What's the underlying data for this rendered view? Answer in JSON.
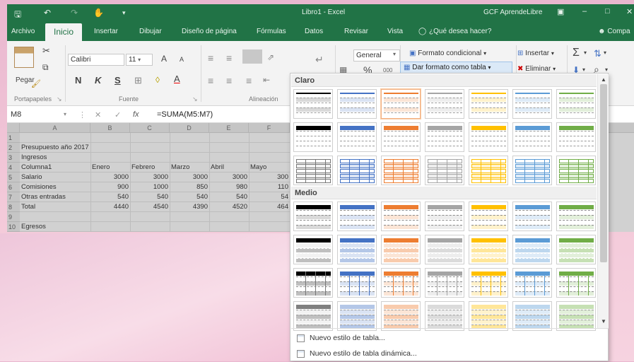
{
  "titlebar": {
    "doc_title": "Libro1  -  Excel",
    "user": "GCF AprendeLibre",
    "save_icon": "🖫",
    "undo_icon": "↶",
    "redo_icon": "↷",
    "touch_icon": "✋",
    "dropdown_icon": "▾",
    "ribbon_opts_icon": "▣",
    "minimize_icon": "–",
    "restore_icon": "□",
    "close_icon": "✕"
  },
  "tabs": [
    {
      "label": "Archivo",
      "active": false
    },
    {
      "label": "Inicio",
      "active": true
    },
    {
      "label": "Insertar",
      "active": false
    },
    {
      "label": "Dibujar",
      "active": false
    },
    {
      "label": "Diseño de página",
      "active": false
    },
    {
      "label": "Fórmulas",
      "active": false
    },
    {
      "label": "Datos",
      "active": false
    },
    {
      "label": "Revisar",
      "active": false
    },
    {
      "label": "Vista",
      "active": false
    }
  ],
  "tellme": "¿Qué desea hacer?",
  "share": "Compa",
  "ribbon": {
    "paste_label": "Pegar",
    "clipboard_group": "Portapapeles",
    "font_name": "Calibri",
    "font_size": "11",
    "bold": "N",
    "italic": "K",
    "underline": "S",
    "grow_font": "A",
    "shrink_font": "A",
    "font_color": "A",
    "font_group": "Fuente",
    "alignment_group": "Alineación",
    "number_format": "General",
    "percent": "%",
    "comma": "000",
    "conditional_format": "Formato condicional",
    "format_as_table": "Dar formato como tabla",
    "insert": "Insertar",
    "delete": "Eliminar",
    "sum_icon": "Σ",
    "sort_icon": "⇅",
    "find_icon": "⌕",
    "fill_icon": "⬇",
    "clear_icon": "✖",
    "dropdown_arrow": "▾",
    "launcher_icon": "↘"
  },
  "formula_bar": {
    "name_box": "M8",
    "cancel": "✕",
    "enter": "✓",
    "fx": "fx",
    "formula": "=SUMA(M5:M7)"
  },
  "sheet": {
    "columns": [
      "A",
      "B",
      "C",
      "D",
      "E",
      "F"
    ],
    "rows": [
      {
        "num": "1",
        "cells": [
          "",
          "",
          "",
          "",
          "",
          ""
        ]
      },
      {
        "num": "2",
        "cells": [
          "Presupuesto año 2017",
          "",
          "",
          "",
          "",
          ""
        ]
      },
      {
        "num": "3",
        "cells": [
          "Ingresos",
          "",
          "",
          "",
          "",
          ""
        ]
      },
      {
        "num": "4",
        "cells": [
          "Columna1",
          "Enero",
          "Febrero",
          "Marzo",
          "Abril",
          "Mayo"
        ]
      },
      {
        "num": "5",
        "cells": [
          "Salario",
          "3000",
          "3000",
          "3000",
          "3000",
          "300"
        ]
      },
      {
        "num": "6",
        "cells": [
          "Comisiones",
          "900",
          "1000",
          "850",
          "980",
          "110"
        ]
      },
      {
        "num": "7",
        "cells": [
          "Otras entradas",
          "540",
          "540",
          "540",
          "540",
          "54"
        ]
      },
      {
        "num": "8",
        "cells": [
          "Total",
          "4440",
          "4540",
          "4390",
          "4520",
          "464"
        ]
      },
      {
        "num": "9",
        "cells": [
          "",
          "",
          "",
          "",
          "",
          ""
        ]
      },
      {
        "num": "10",
        "cells": [
          "Egresos",
          "",
          "",
          "",
          "",
          ""
        ]
      }
    ]
  },
  "gallery": {
    "sections": [
      {
        "label": "Claro"
      },
      {
        "label": "Medio"
      }
    ],
    "palette": [
      "#595959",
      "#4472c4",
      "#ed7d31",
      "#a5a5a5",
      "#ffc000",
      "#5b9bd5",
      "#70ad47"
    ],
    "light_tints": [
      "#f2f2f2",
      "#dae3f3",
      "#fbe5d6",
      "#ededed",
      "#fff2cc",
      "#deebf7",
      "#e2efda"
    ],
    "medium_tints": [
      "#bfbfbf",
      "#b4c7e7",
      "#f8cbad",
      "#dbdbdb",
      "#ffe699",
      "#bdd7ee",
      "#c6e0b4"
    ],
    "new_table_style": "Nuevo estilo de tabla...",
    "new_pivot_style": "Nuevo estilo de tabla dinámica...",
    "scroll_up": "▲",
    "scroll_down": "▼"
  }
}
